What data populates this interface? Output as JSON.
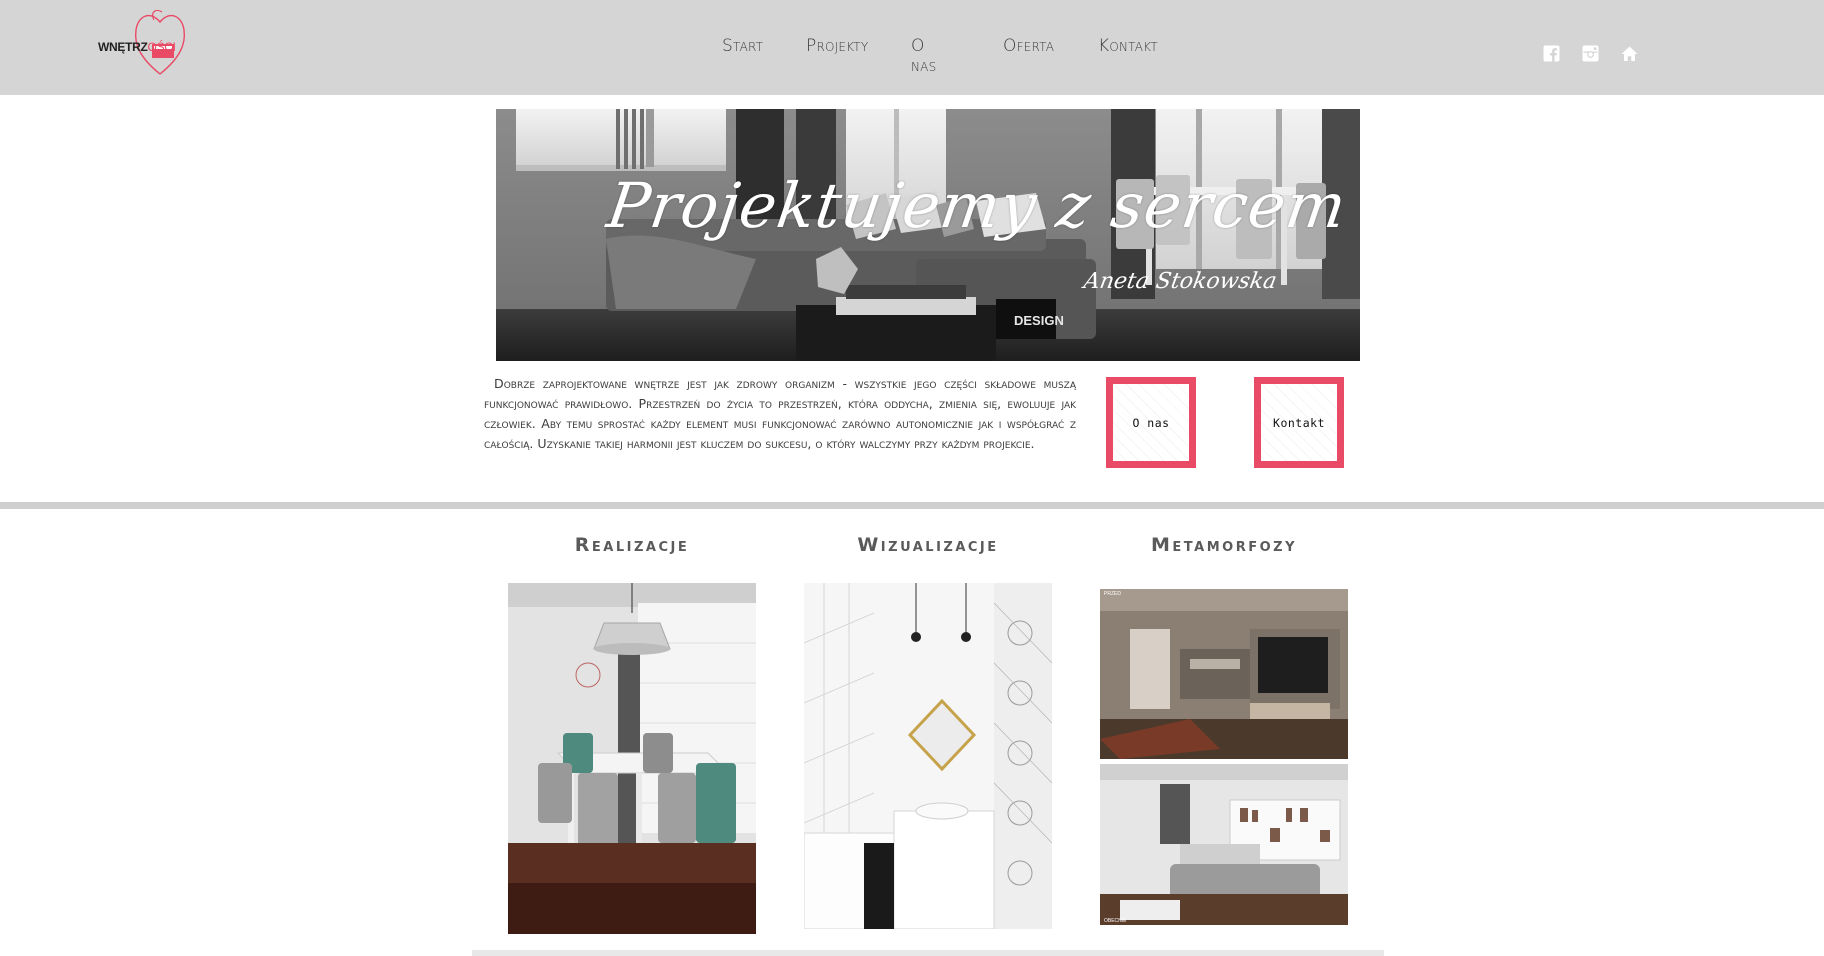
{
  "header": {
    "logo": {
      "word": "WNĘTRZ",
      "word_accent": "OŚCI"
    },
    "nav": [
      {
        "label": "Start"
      },
      {
        "label": "Projekty"
      },
      {
        "label": "O nas"
      },
      {
        "label": "Oferta"
      },
      {
        "label": "Kontakt"
      }
    ],
    "social_icons": [
      "facebook-icon",
      "instagram-icon",
      "home-icon"
    ]
  },
  "hero": {
    "title": "Projektujemy z sercem",
    "signature": "Aneta Stokowska",
    "book_label": "DESIGN"
  },
  "intro": {
    "text": "Dobrze zaprojektowane wnętrze jest jak zdrowy organizm - wszystkie jego części składowe muszą funkcjonować prawidłowo. Przestrzeń do życia to przestrzeń, która oddycha, zmienia się, ewoluuje jak człowiek. Aby temu sprostać każdy element musi funkcjonować zarówno autonomicznie jak i współgrać z całością. Uzyskanie takiej harmonii jest kluczem do sukcesu, o który walczymy przy każdym projekcie."
  },
  "promo_buttons": [
    {
      "label": "O nas"
    },
    {
      "label": "Kontakt"
    }
  ],
  "galleries": [
    {
      "title": "Realizacje"
    },
    {
      "title": "Wizualizacje"
    },
    {
      "title": "Metamorfozy"
    }
  ],
  "metamorfozy_labels": {
    "before": "PRZED",
    "after": "OBECNIE"
  },
  "colors": {
    "header_bg": "#d5d5d5",
    "accent": "#e94a66",
    "divider": "#cfcfcf",
    "text": "#3d3d3d"
  }
}
